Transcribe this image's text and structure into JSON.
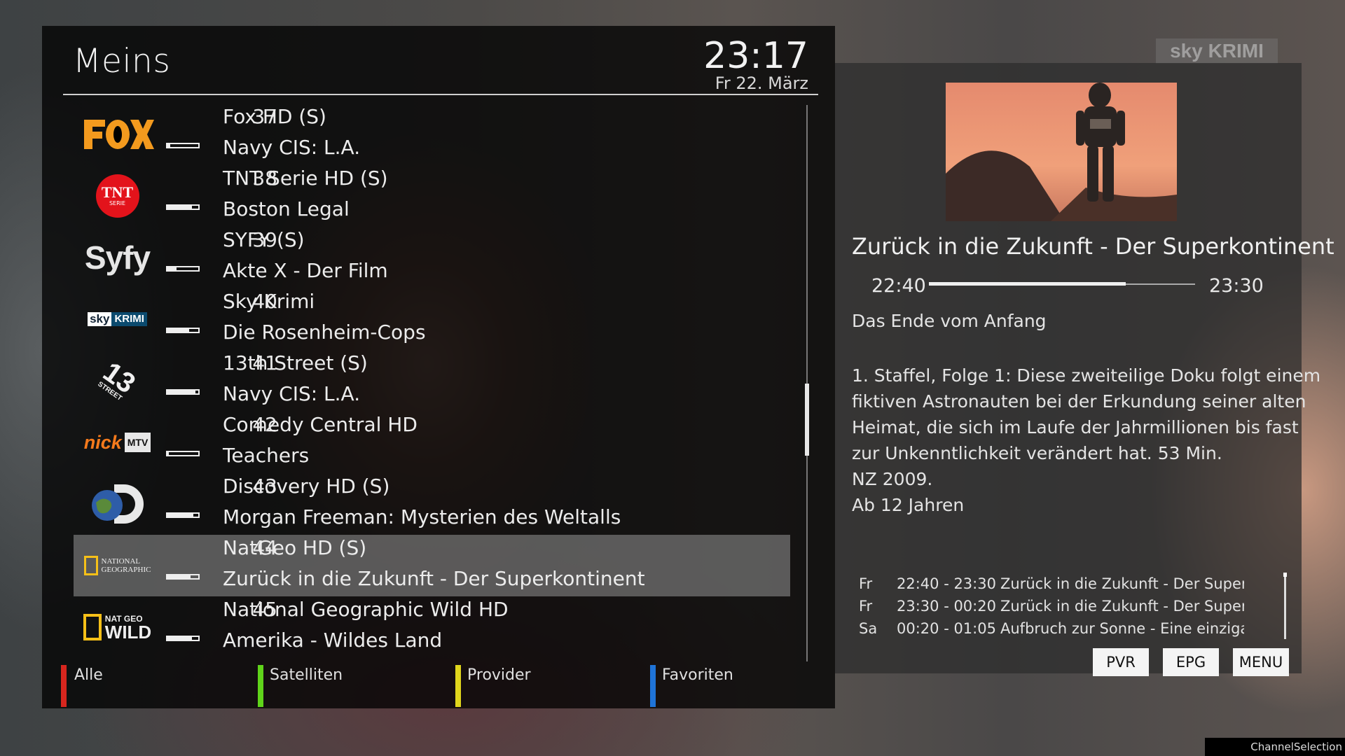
{
  "list": {
    "title": "Meins",
    "time": "23:17",
    "date": "Fr 22. März"
  },
  "channels": [
    {
      "number": "37",
      "name": "Fox HD (S)",
      "event": "Navy CIS: L.A.",
      "progress": 0.08,
      "logo_icon": "fox-logo"
    },
    {
      "number": "38",
      "name": "TNT Serie HD (S)",
      "event": "Boston Legal",
      "progress": 0.8,
      "logo_icon": "tnt-serie-logo",
      "logo_text": "TNT",
      "logo_sub": "SERIE"
    },
    {
      "number": "39",
      "name": "SYFY (S)",
      "event": "Akte X - Der Film",
      "progress": 0.3,
      "logo_icon": "syfy-logo",
      "logo_text": "Syfy"
    },
    {
      "number": "40",
      "name": "Sky Krimi",
      "event": "Die Rosenheim-Cops",
      "progress": 0.7,
      "logo_icon": "sky-krimi-logo",
      "logo_a": "sky",
      "logo_b": "KRIMI"
    },
    {
      "number": "41",
      "name": "13th Street (S)",
      "event": "Navy CIS: L.A.",
      "progress": 0.9,
      "logo_icon": "13th-street-logo",
      "logo_text": "13",
      "logo_sub": "STREET"
    },
    {
      "number": "42",
      "name": "Comedy Central HD",
      "event": "Teachers",
      "progress": 0.05,
      "logo_icon": "nick-mtv-logo",
      "logo_a": "nick",
      "logo_b": "MTV"
    },
    {
      "number": "43",
      "name": "Discovery HD (S)",
      "event": "Morgan Freeman: Mysterien des Weltalls",
      "progress": 0.85,
      "logo_icon": "discovery-logo"
    },
    {
      "number": "44",
      "name": "NatGeo HD (S)",
      "event": "Zurück in die Zukunft - Der Superkontinent",
      "progress": 0.75,
      "logo_icon": "national-geographic-logo",
      "logo_a": "NATIONAL",
      "logo_b": "GEOGRAPHIC",
      "selected": true
    },
    {
      "number": "45",
      "name": "National Geographic Wild HD",
      "event": "Amerika - Wildes Land",
      "progress": 0.8,
      "logo_icon": "nat-geo-wild-logo",
      "logo_a": "NAT GEO",
      "logo_b": "WILD"
    }
  ],
  "color_buttons": [
    {
      "label": "Alle",
      "color": "#d7261e"
    },
    {
      "label": "Satelliten",
      "color": "#5fd41a"
    },
    {
      "label": "Provider",
      "color": "#e0d61c"
    },
    {
      "label": "Favoriten",
      "color": "#1f74d8"
    }
  ],
  "detail": {
    "title": "Zurück in die Zukunft - Der Superkontinent",
    "start": "22:40",
    "end": "23:30",
    "progress": 0.74,
    "subtitle": "Das Ende vom Anfang",
    "description": [
      "1. Staffel, Folge 1: Diese zweiteilige Doku folgt einem",
      "fiktiven Astronauten bei der Erkundung seiner alten",
      "Heimat, die sich im Laufe der Jahrmillionen bis fast",
      "zur Unkenntlichkeit verändert hat. 53 Min.",
      "NZ 2009.",
      "Ab 12 Jahren"
    ],
    "epg": [
      {
        "day": "Fr",
        "time": "22:40 - 23:30",
        "name": "Zurück in die Zukunft - Der Superkontinent"
      },
      {
        "day": "Fr",
        "time": "23:30 - 00:20",
        "name": "Zurück in die Zukunft - Der Superkontinent"
      },
      {
        "day": "Sa",
        "time": "00:20 - 01:05",
        "name": "Aufbruch zur Sonne - Eine einzigartige Reise"
      }
    ],
    "keys": [
      "PVR",
      "EPG",
      "MENU"
    ]
  },
  "watermark": {
    "a": "sky",
    "b": "KRIMI"
  },
  "screen_name": "ChannelSelection",
  "colors": {
    "accent_selected": "#8c8c8c",
    "panel": "#000000"
  }
}
